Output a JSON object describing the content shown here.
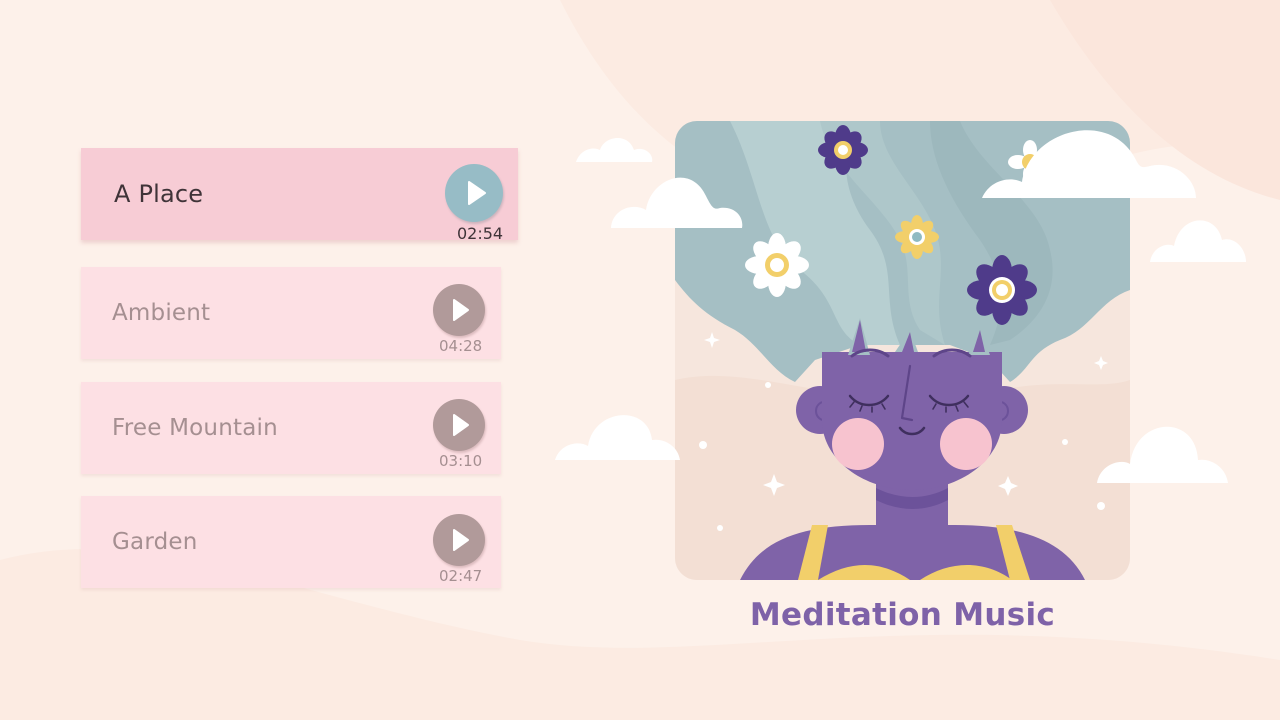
{
  "album": {
    "title": "Meditation Music"
  },
  "tracks": [
    {
      "title": "A Place",
      "duration": "02:54",
      "active": true
    },
    {
      "title": "Ambient",
      "duration": "04:28",
      "active": false
    },
    {
      "title": "Free Mountain",
      "duration": "03:10",
      "active": false
    },
    {
      "title": "Garden",
      "duration": "02:47",
      "active": false
    }
  ],
  "colors": {
    "background": "#fdf1ea",
    "active_row": "#f7ccd5",
    "inactive_row": "#fde0e4",
    "active_play": "#97bcc6",
    "inactive_play": "#b19a9a",
    "accent_purple": "#7e62a8"
  },
  "icons": {
    "play": "play-icon"
  }
}
